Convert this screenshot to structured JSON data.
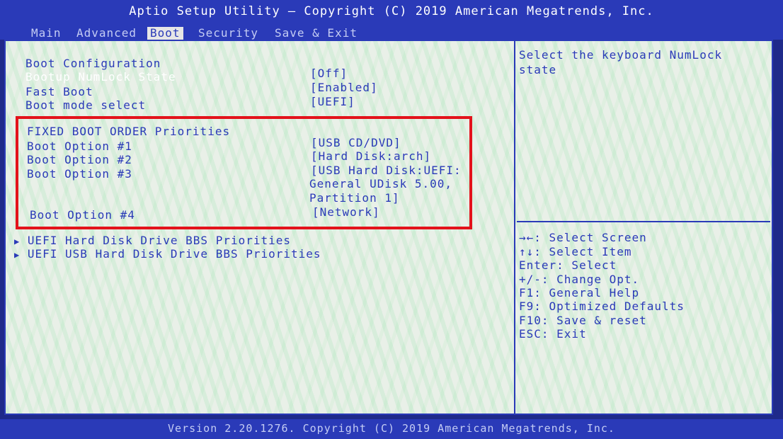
{
  "header": {
    "title": "Aptio Setup Utility – Copyright (C) 2019 American Megatrends, Inc.",
    "tabs": [
      "Main",
      "Advanced",
      "Boot",
      "Security",
      "Save & Exit"
    ],
    "active_tab": "Boot"
  },
  "boot_config": {
    "section_title": "Boot Configuration",
    "items": [
      {
        "label": "Bootup NumLock State",
        "value": "[Off]"
      },
      {
        "label": "Fast Boot",
        "value": "[Enabled]"
      },
      {
        "label": "Boot mode select",
        "value": "[UEFI]"
      }
    ]
  },
  "fixed_boot_order": {
    "section_title": "FIXED BOOT ORDER Priorities",
    "options": [
      {
        "label": "Boot Option #1",
        "value": "[USB CD/DVD]"
      },
      {
        "label": "Boot Option #2",
        "value": "[Hard Disk:arch]"
      },
      {
        "label": "Boot Option #3",
        "value_lines": [
          "[USB Hard Disk:UEFI:",
          "General UDisk 5.00,",
          "Partition 1]"
        ]
      },
      {
        "label": "Boot Option #4",
        "value": "[Network]"
      }
    ]
  },
  "submenus": [
    "UEFI Hard Disk Drive BBS Priorities",
    "UEFI USB Hard Disk Drive BBS Priorities"
  ],
  "help": {
    "description_lines": [
      "Select the keyboard NumLock",
      "state"
    ],
    "keys": [
      "→←: Select Screen",
      "↑↓: Select Item",
      "Enter: Select",
      "+/-: Change Opt.",
      "F1: General Help",
      "F9: Optimized Defaults",
      "F10: Save & reset",
      "ESC: Exit"
    ]
  },
  "footer": {
    "text": "Version 2.20.1276. Copyright (C) 2019 American Megatrends, Inc."
  },
  "colors": {
    "bios_blue": "#2a3ab8",
    "panel_bg": "#e9f0e8",
    "highlight_red": "#e3121b"
  }
}
